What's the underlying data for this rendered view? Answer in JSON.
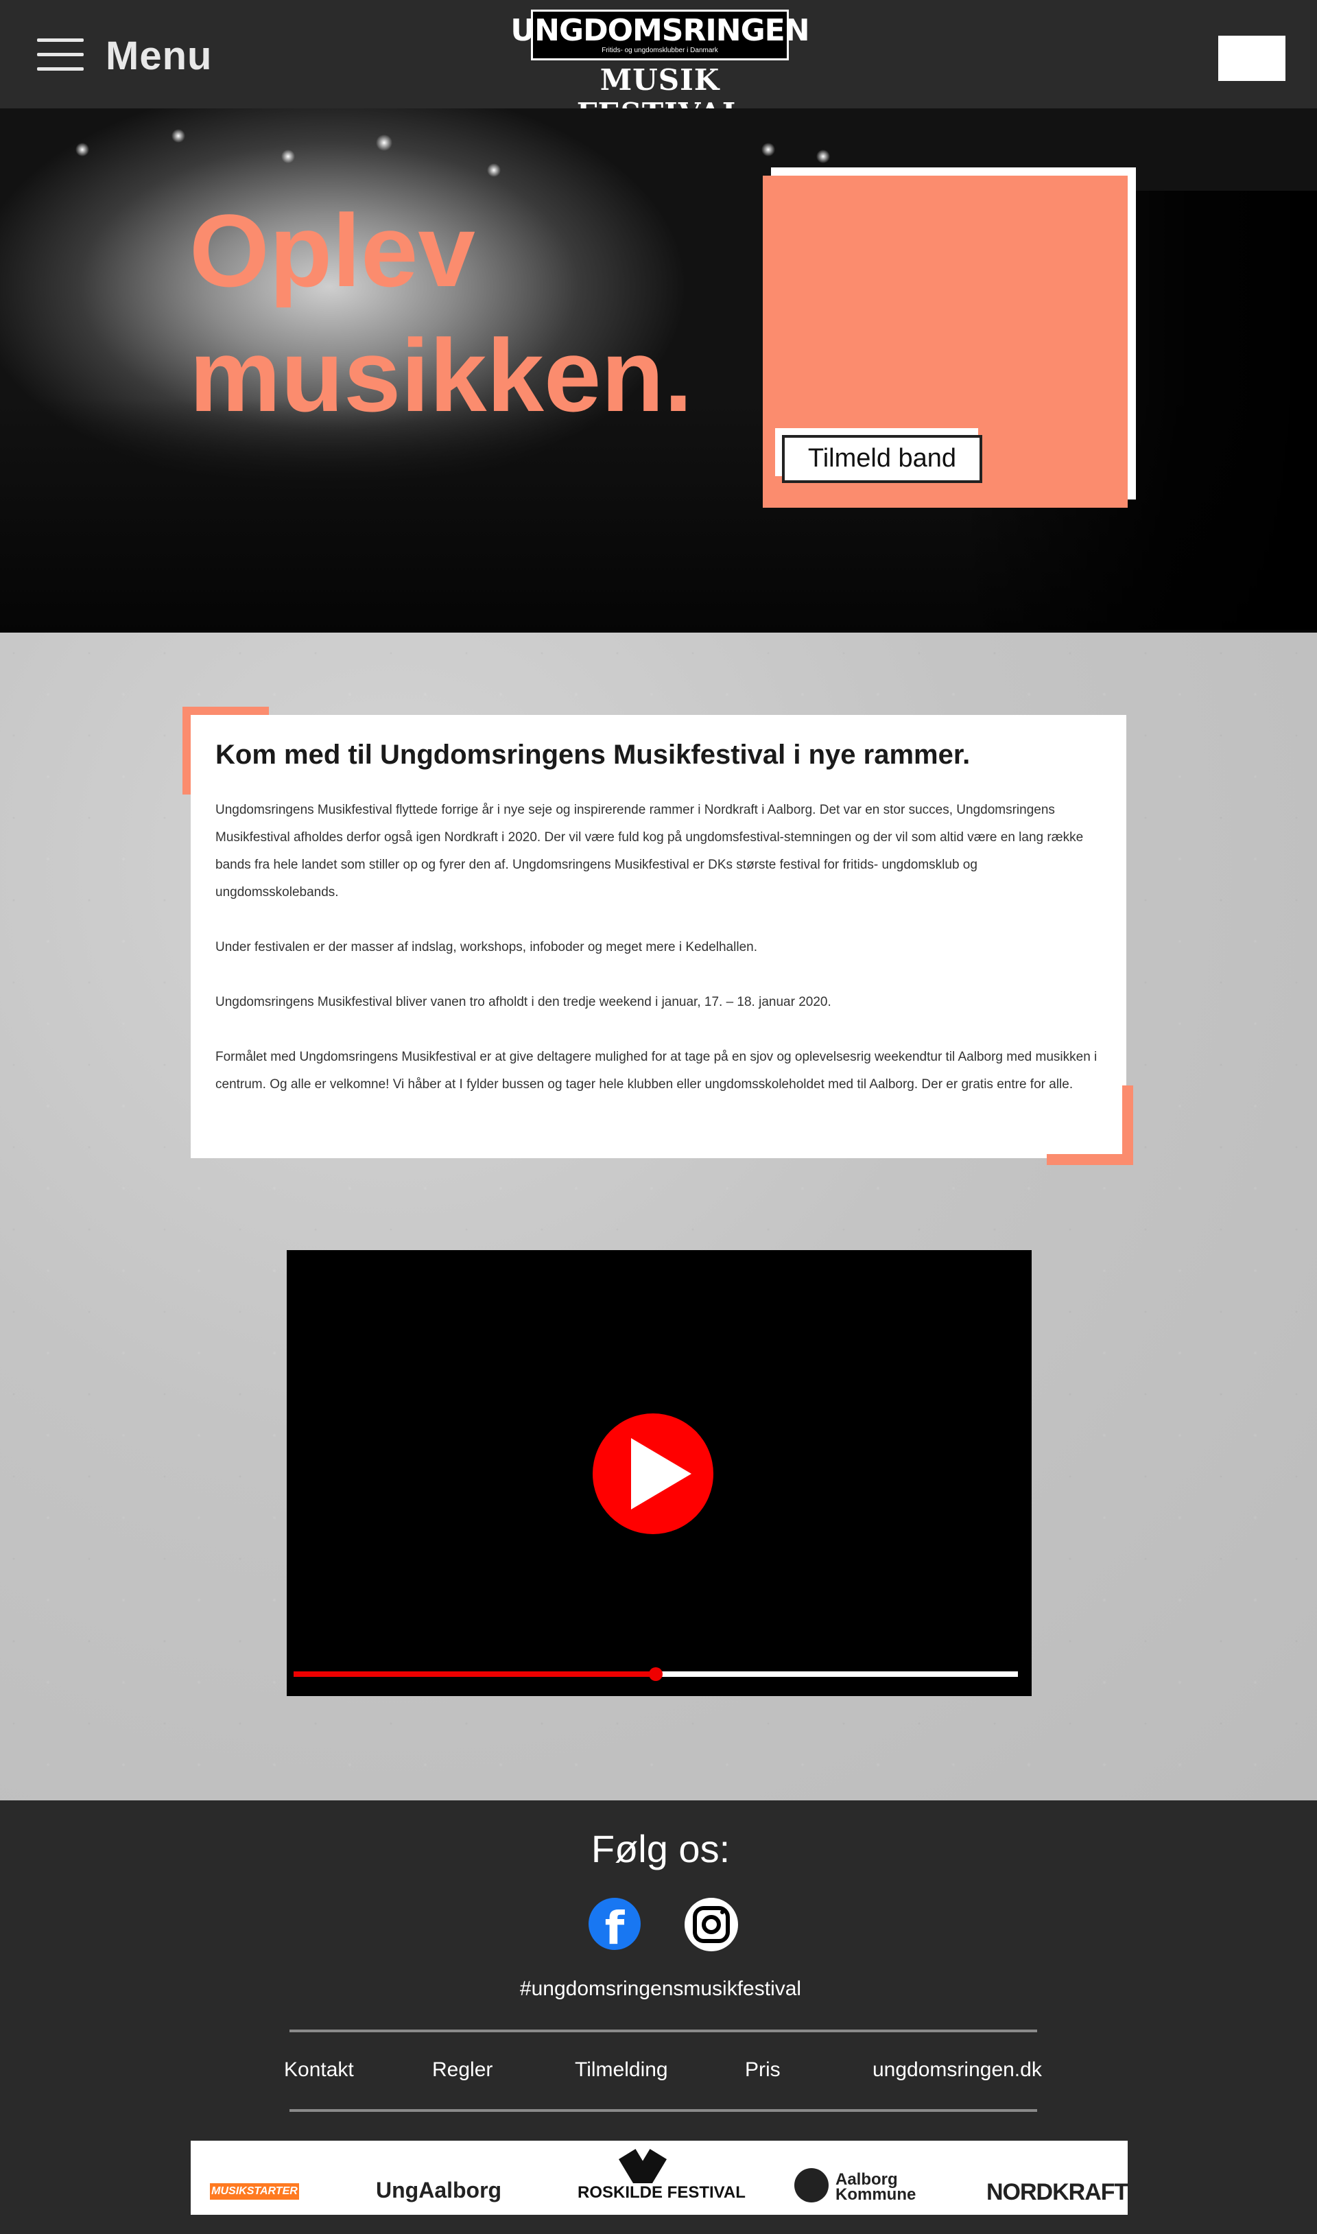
{
  "header": {
    "menu_label": "Menu",
    "logo_top": "UNGDOMSRINGEN",
    "logo_tagline": "Fritids- og ungdomsklubber i Danmark",
    "logo_bottom": "MUSIK FESTIVAL"
  },
  "hero": {
    "title_line1": "Oplev",
    "title_line2": "musikken.",
    "signup_label": "Tilmeld band"
  },
  "article": {
    "heading": "Kom med til Ungdomsringens Musikfestival i nye rammer.",
    "paragraphs": [
      "Ungdomsringens Musikfestival flyttede forrige år i nye seje og inspirerende rammer i Nordkraft i Aalborg. Det var en stor succes, Ungdomsringens Musikfestival afholdes derfor også igen Nordkraft i 2020. Der vil være fuld kog på ungdomsfestival-stemningen og der vil som altid være en lang række bands fra hele landet som stiller op og fyrer den af. Ungdomsringens Musikfestival er DKs største festival for fritids- ungdomsklub og ungdomsskolebands.",
      "Under festivalen er der masser af indslag, workshops, infoboder og meget mere i Kedelhallen.",
      "Ungdomsringens Musikfestival bliver vanen tro afholdt i den tredje weekend i januar, 17. – 18. januar 2020.",
      "Formålet med Ungdomsringens Musikfestival er at give deltagere mulighed for at tage på en sjov og oplevelsesrig weekendtur til Aalborg med musikken i centrum. Og alle er velkomne! Vi håber at I fylder bussen og tager hele klubben eller ungdomsskoleholdet med til Aalborg. Der er gratis entre for alle."
    ]
  },
  "video": {
    "progress": 0.5,
    "accent_color": "#ff0000"
  },
  "footer": {
    "follow_label": "Følg os:",
    "facebook_glyph": "f",
    "hashtag": "#ungdomsringensmusikfestival",
    "nav": [
      "Kontakt",
      "Regler",
      "Tilmelding",
      "Pris",
      "ungdomsringen.dk"
    ],
    "sponsors": {
      "musikstarter": "MUSIKSTARTER",
      "ungaalborg": "UngAalborg",
      "roskilde": "ROSKILDE FESTIVAL",
      "aalborg_kommune_1": "Aalborg",
      "aalborg_kommune_2": "Kommune",
      "nordkraft": "NORDKRAFT"
    }
  },
  "colors": {
    "accent": "#fb8c6e",
    "header_bg": "#2b2b2b"
  }
}
